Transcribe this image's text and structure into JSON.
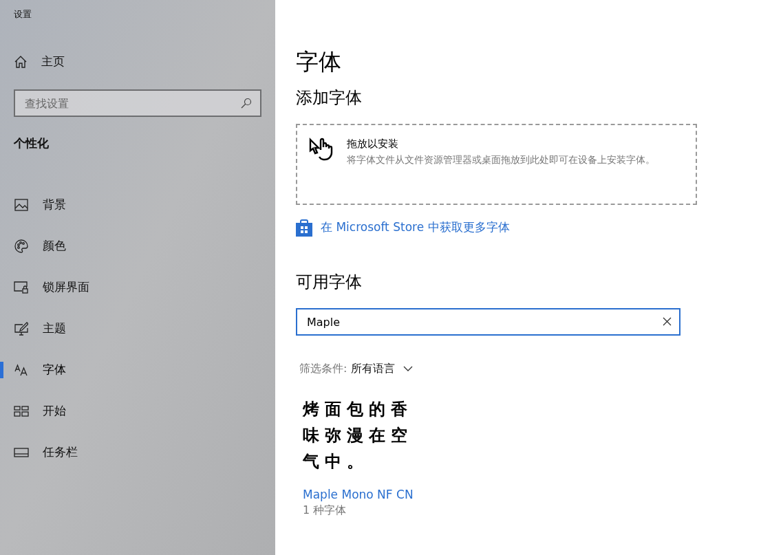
{
  "window": {
    "title": "设置"
  },
  "sidebar": {
    "home": "主页",
    "search": {
      "placeholder": "查找设置"
    },
    "section": "个性化",
    "items": [
      {
        "label": "背景",
        "selected": false
      },
      {
        "label": "颜色",
        "selected": false
      },
      {
        "label": "锁屏界面",
        "selected": false
      },
      {
        "label": "主题",
        "selected": false
      },
      {
        "label": "字体",
        "selected": true
      },
      {
        "label": "开始",
        "selected": false
      },
      {
        "label": "任务栏",
        "selected": false
      }
    ]
  },
  "page": {
    "title": "字体",
    "add_heading": "添加字体",
    "drop_zone": {
      "title": "拖放以安装",
      "description": "将字体文件从文件资源管理器或桌面拖放到此处即可在设备上安装字体。"
    },
    "store_link": "在 Microsoft Store 中获取更多字体",
    "available_heading": "可用字体",
    "font_search": {
      "value": "Maple"
    },
    "filter": {
      "label": "筛选条件:",
      "value": "所有语言"
    },
    "fonts": [
      {
        "sample": "烤面包的香味弥漫在空气中。",
        "name": "Maple Mono NF CN",
        "count": "1 种字体"
      }
    ]
  }
}
